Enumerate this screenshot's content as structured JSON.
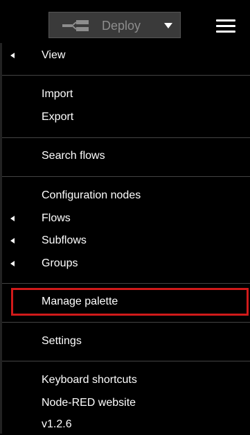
{
  "toolbar": {
    "deploy_label": "Deploy",
    "deploy_icon": "deploy-icon",
    "menu_icon": "hamburger-menu-icon"
  },
  "menu": {
    "items": [
      {
        "label": "View",
        "submenu": true
      },
      {
        "label": "Import",
        "submenu": false
      },
      {
        "label": "Export",
        "submenu": false
      },
      {
        "label": "Search flows",
        "submenu": false
      },
      {
        "label": "Configuration nodes",
        "submenu": false
      },
      {
        "label": "Flows",
        "submenu": true
      },
      {
        "label": "Subflows",
        "submenu": true
      },
      {
        "label": "Groups",
        "submenu": true
      },
      {
        "label": "Manage palette",
        "submenu": false,
        "highlighted": true
      },
      {
        "label": "Settings",
        "submenu": false
      },
      {
        "label": "Keyboard shortcuts",
        "submenu": false
      },
      {
        "label": "Node-RED website",
        "submenu": false
      }
    ],
    "version": "v1.2.6"
  },
  "colors": {
    "background": "#000000",
    "deploy_button": "#3a3a3a",
    "highlight_border": "#d11a1a"
  }
}
